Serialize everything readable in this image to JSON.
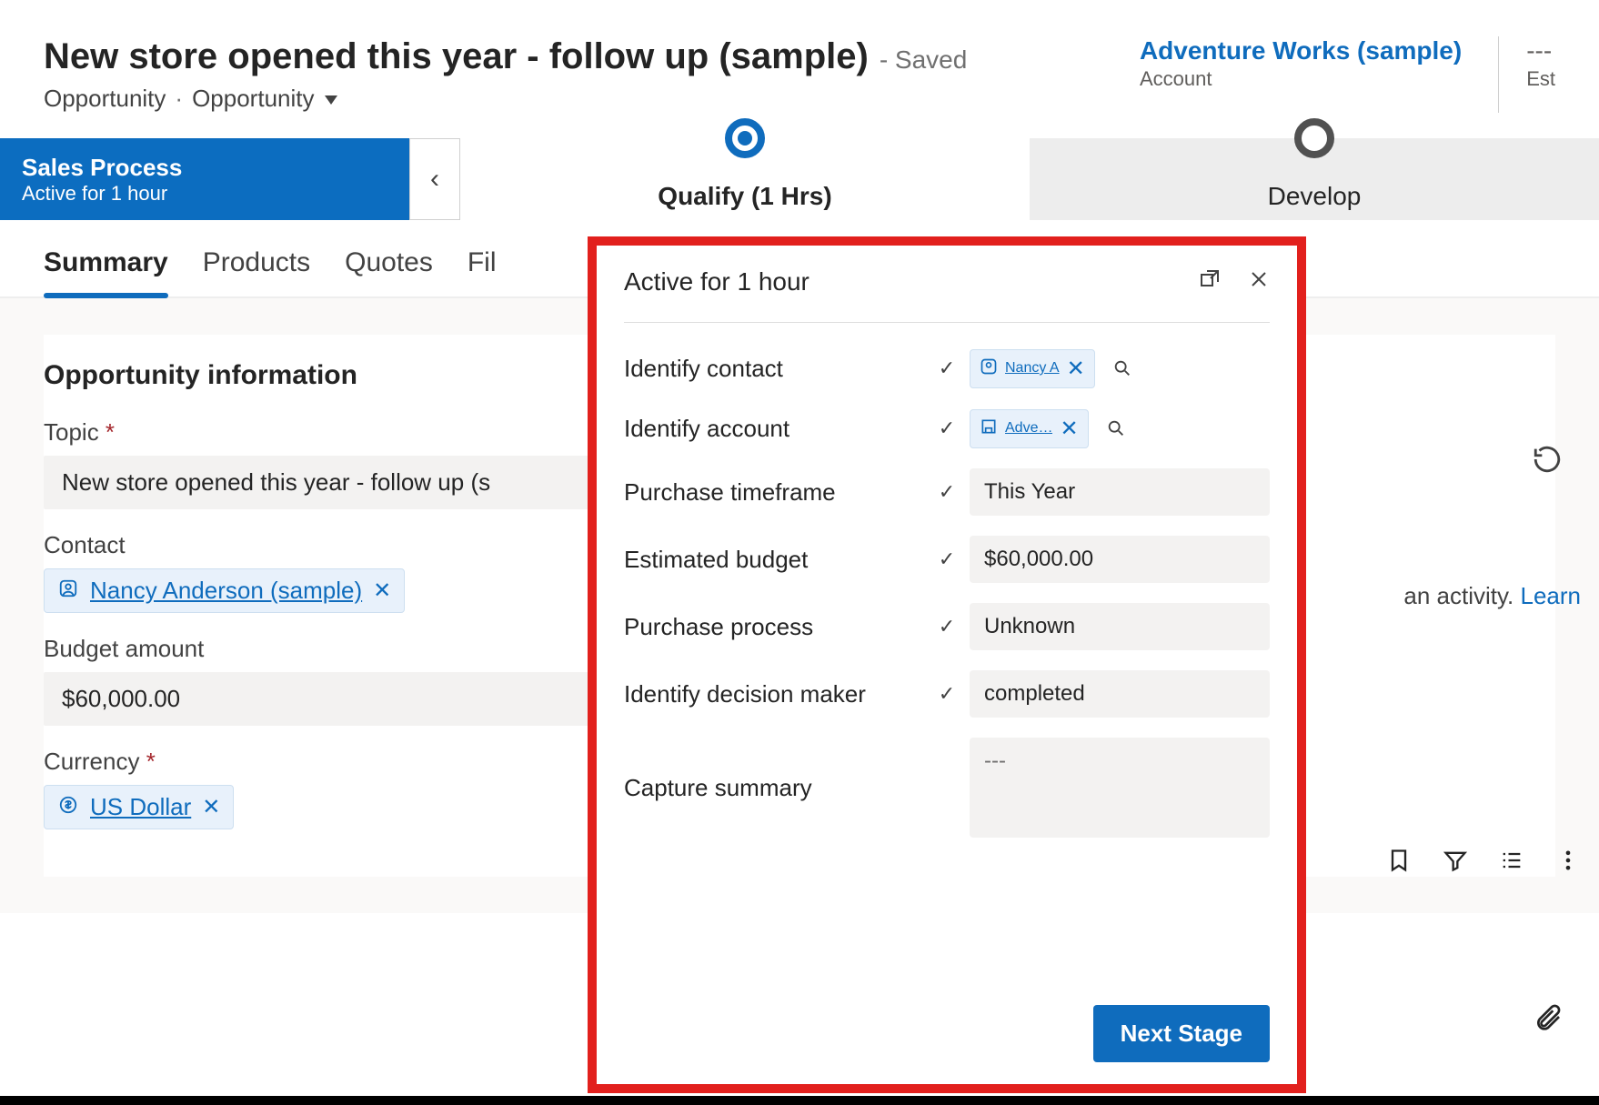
{
  "header": {
    "title": "New store opened this year - follow up (sample)",
    "saved_suffix": "- Saved",
    "entity": "Opportunity",
    "entity_selector": "Opportunity",
    "account_link": "Adventure Works (sample)",
    "account_label": "Account",
    "est_prefix": "Est",
    "dashes": "---"
  },
  "bpf": {
    "name": "Sales Process",
    "active_text": "Active for 1 hour",
    "stage1": "Qualify  (1 Hrs)",
    "stage2": "Develop"
  },
  "tabs": {
    "summary": "Summary",
    "products": "Products",
    "quotes": "Quotes",
    "files": "Fil"
  },
  "section_title": "Opportunity information",
  "fields": {
    "topic_label": "Topic",
    "topic_value": "New store opened this year - follow up (s",
    "contact_label": "Contact",
    "contact_value": "Nancy Anderson (sample)",
    "budget_label": "Budget amount",
    "budget_value": "$60,000.00",
    "currency_label": "Currency",
    "currency_value": "US Dollar"
  },
  "flyout": {
    "title": "Active for 1 hour",
    "rows": {
      "identify_contact": {
        "label": "Identify contact",
        "value": "Nancy A",
        "checked": true,
        "lookup": true
      },
      "identify_account": {
        "label": "Identify account",
        "value": "Adve…",
        "checked": true,
        "lookup": true
      },
      "purchase_timeframe": {
        "label": "Purchase timeframe",
        "value": "This Year",
        "checked": true
      },
      "estimated_budget": {
        "label": "Estimated budget",
        "value": "$60,000.00",
        "checked": true
      },
      "purchase_process": {
        "label": "Purchase process",
        "value": "Unknown",
        "checked": true
      },
      "decision_maker": {
        "label": "Identify decision maker",
        "value": "completed",
        "checked": true
      },
      "capture_summary": {
        "label": "Capture summary",
        "value": "---",
        "checked": false
      }
    },
    "next_stage": "Next Stage"
  },
  "activity_hint_text": "an activity. ",
  "activity_hint_link": "Learn"
}
